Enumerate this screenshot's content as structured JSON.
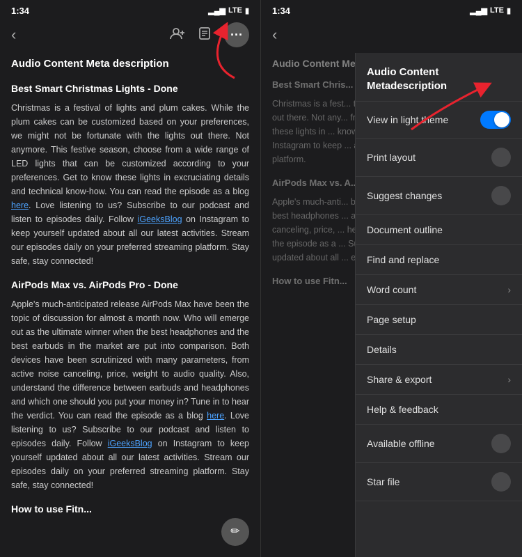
{
  "left_panel": {
    "status": {
      "time": "1:34",
      "signal": "▂▄▆",
      "network": "LTE",
      "battery": "■"
    },
    "document_title": "Audio Content Meta description",
    "sections": [
      {
        "title": "Best Smart Christmas Lights - Done",
        "body": "Christmas is a festival of lights and plum cakes. While the plum cakes can be customized based on your preferences, we might not be fortunate with the lights out there. Not anymore. This festive season, choose from a wide range of LED lights that can be customized according to your preferences. Get to know these lights in excruciating details and technical know-how. You can read the episode as a blog here. Love listening to us? Subscribe to our podcast and listen to episodes daily. Follow iGeeksBlog on Instagram to keep yourself updated about all our latest activities. Stream our episodes daily on your preferred streaming platform. Stay safe, stay connected!"
      },
      {
        "title": "AirPods Max vs. AirPods Pro - Done",
        "body": "Apple's much-anticipated release AirPods Max have been the topic of discussion for almost a month now. Who will emerge out as the ultimate winner when the best headphones and the best earbuds in the market are put into comparison. Both devices have been scrutinized with many parameters, from active noise canceling, price, weight to audio quality. Also, understand the difference between earbuds and headphones and which one should you put your money in? Tune in to hear the verdict. You can read the episode as a blog here. Love listening to us? Subscribe to our podcast and listen to episodes daily. Follow iGeeksBlog on Instagram to keep yourself updated about all our latest activities. Stream our episodes daily on your preferred streaming platform. Stay safe, stay connected!"
      },
      {
        "title": "How to use Fitness..."
      }
    ]
  },
  "right_panel": {
    "status": {
      "time": "1:34",
      "signal": "▂▄▆",
      "network": "LTE",
      "battery": "■"
    },
    "menu_header": "Audio Content Metadescription",
    "menu_items": [
      {
        "label": "View in light theme",
        "control": "toggle_on"
      },
      {
        "label": "Print layout",
        "control": "toggle_off"
      },
      {
        "label": "Suggest changes",
        "control": "toggle_off"
      },
      {
        "label": "Document outline",
        "control": "none"
      },
      {
        "label": "Find and replace",
        "control": "none"
      },
      {
        "label": "Word count",
        "control": "chevron"
      },
      {
        "label": "Page setup",
        "control": "none"
      },
      {
        "label": "Details",
        "control": "none"
      },
      {
        "label": "Share & export",
        "control": "chevron"
      },
      {
        "label": "Help & feedback",
        "control": "none"
      },
      {
        "label": "Available offline",
        "control": "toggle_off"
      },
      {
        "label": "Star file",
        "control": "toggle_off"
      }
    ]
  },
  "icons": {
    "back": "‹",
    "add_person": "👤+",
    "document": "☰",
    "more": "•••",
    "edit": "✏",
    "chevron_right": "›"
  }
}
